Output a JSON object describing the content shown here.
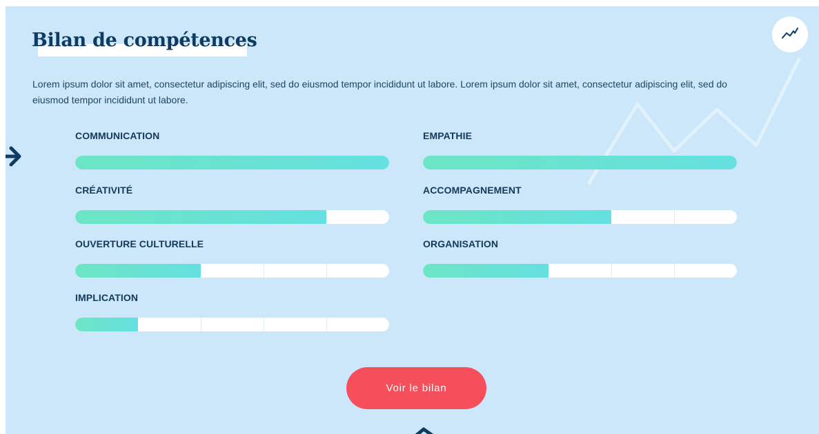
{
  "header": {
    "title": "Bilan de compétences"
  },
  "intro": {
    "text": "Lorem ipsum dolor sit amet, consectetur adipiscing elit, sed do eiusmod tempor incididunt ut labore. Lorem ipsum dolor sit amet, consectetur adipiscing elit, sed do eiusmod tempor incididunt ut labore."
  },
  "skills": [
    {
      "label": "COMMUNICATION",
      "level": 1.0
    },
    {
      "label": "EMPATHIE",
      "level": 1.0
    },
    {
      "label": "CRÉATIVITÉ",
      "level": 0.8
    },
    {
      "label": "ACCOMPAGNEMENT",
      "level": 0.6
    },
    {
      "label": "OUVERTURE CULTURELLE",
      "level": 0.4
    },
    {
      "label": "ORGANISATION",
      "level": 0.4
    },
    {
      "label": "IMPLICATION",
      "level": 0.2
    }
  ],
  "cta": {
    "label": "Voir le bilan"
  },
  "icons": {
    "trend": "trend-up-icon",
    "arrow_left": "arrow-right-icon",
    "arrow_bottom": "arrow-up-icon"
  },
  "colors": {
    "background": "#cbe7f9",
    "title": "#0e3b62",
    "bar_fill_start": "#6ce5c4",
    "bar_fill_end": "#66e0e0",
    "bar_track": "#ffffff",
    "button": "#f54f5b"
  }
}
